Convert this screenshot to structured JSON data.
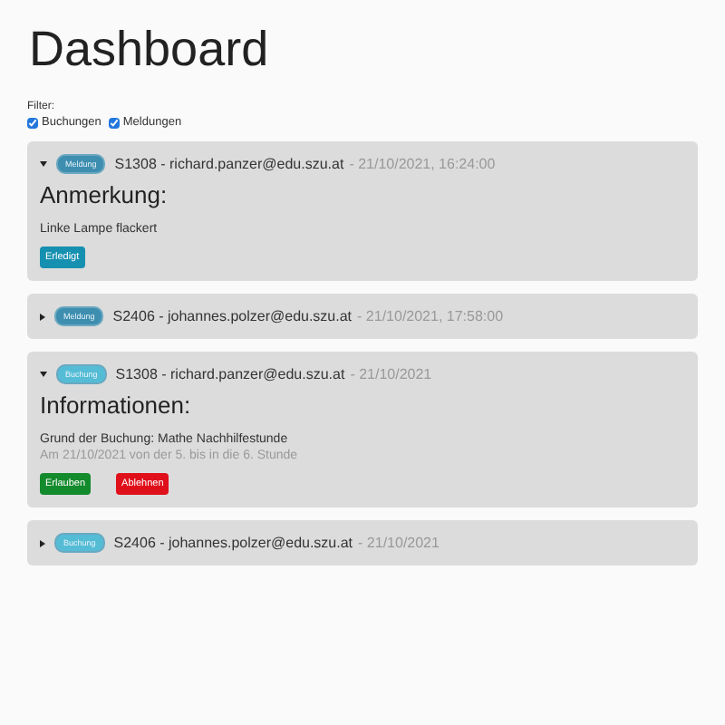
{
  "title": "Dashboard",
  "filter": {
    "label": "Filter:",
    "options": [
      {
        "label": "Buchungen",
        "checked": true
      },
      {
        "label": "Meldungen",
        "checked": true
      }
    ]
  },
  "items": [
    {
      "badge": "Meldung",
      "color": "#3e8eb0",
      "heading": "S1308 - richard.panzer@edu.szu.at",
      "date": "- 21/10/2021, 16:24:00",
      "expanded": true,
      "section_title": "Anmerkung:",
      "lines": [
        "Linke Lampe flackert"
      ],
      "buttons": [
        {
          "label": "Erledigt",
          "kind": "info"
        }
      ]
    },
    {
      "badge": "Meldung",
      "color": "#3e8eb0",
      "heading": "S2406 - johannes.polzer@edu.szu.at",
      "date": "- 21/10/2021, 17:58:00",
      "expanded": false
    },
    {
      "badge": "Buchung",
      "color": "#55bcd6",
      "heading": "S1308 - richard.panzer@edu.szu.at",
      "date": "- 21/10/2021",
      "expanded": true,
      "section_title": "Informationen:",
      "lines": [
        "Grund der Buchung: Mathe Nachhilfestunde",
        "Am 21/10/2021 von der 5. bis in die 6. Stunde"
      ],
      "buttons": [
        {
          "label": "Erlauben",
          "kind": "success"
        },
        {
          "label": "Ablehnen",
          "kind": "danger"
        }
      ]
    },
    {
      "badge": "Buchung",
      "color": "#55bcd6",
      "heading": "S2406 - johannes.polzer@edu.szu.at",
      "date": "- 21/10/2021",
      "expanded": false
    }
  ]
}
